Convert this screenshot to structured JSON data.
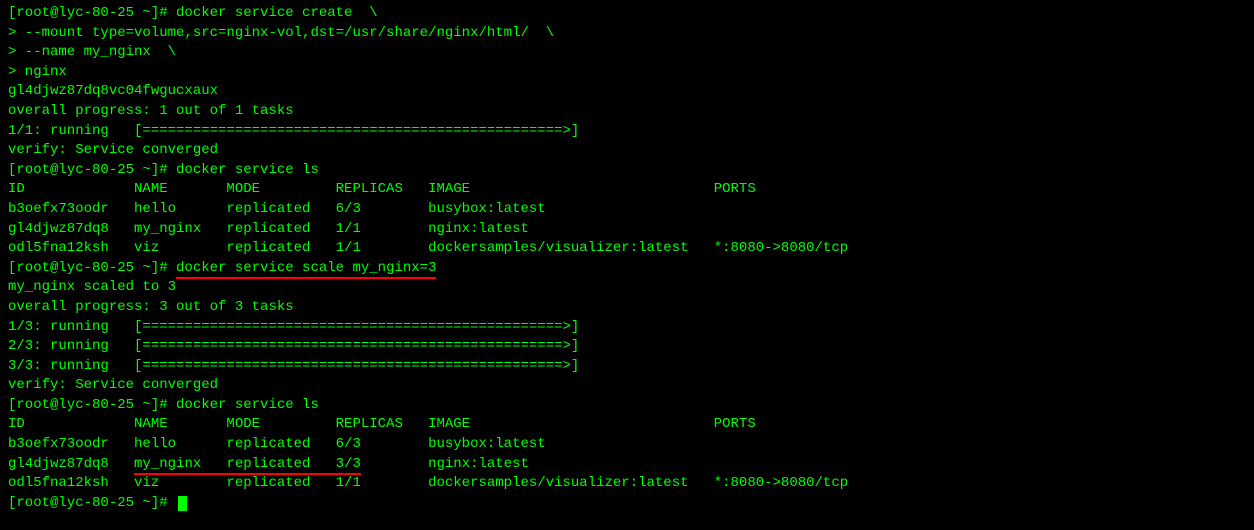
{
  "prompt": {
    "user": "root",
    "host": "lyc-80-25",
    "path": "~",
    "symbol": "#"
  },
  "lines": {
    "l1": "[root@lyc-80-25 ~]# docker service create  \\",
    "l2": "> --mount type=volume,src=nginx-vol,dst=/usr/share/nginx/html/  \\",
    "l3": "> --name my_nginx  \\",
    "l4": "> nginx",
    "l5": "gl4djwz87dq8vc04fwgucxaux",
    "l6": "overall progress: 1 out of 1 tasks",
    "l7": "1/1: running   [==================================================>]",
    "l8": "verify: Service converged",
    "l9": "[root@lyc-80-25 ~]# docker service ls",
    "l10": "ID             NAME       MODE         REPLICAS   IMAGE                             PORTS",
    "l11": "b3oefx73oodr   hello      replicated   6/3        busybox:latest",
    "l12": "gl4djwz87dq8   my_nginx   replicated   1/1        nginx:latest",
    "l13": "odl5fna12ksh   viz        replicated   1/1        dockersamples/visualizer:latest   *:8080->8080/tcp",
    "l14_prefix": "[root@lyc-80-25 ~]# ",
    "l14_cmd": "docker service scale my_nginx=3",
    "l15": "my_nginx scaled to 3",
    "l16": "overall progress: 3 out of 3 tasks",
    "l17": "1/3: running   [==================================================>]",
    "l18": "2/3: running   [==================================================>]",
    "l19": "3/3: running   [==================================================>]",
    "l20": "verify: Service converged",
    "l21": "[root@lyc-80-25 ~]# docker service ls",
    "l22": "ID             NAME       MODE         REPLICAS   IMAGE                             PORTS",
    "l23": "b3oefx73oodr   hello      replicated   6/3        busybox:latest",
    "l24_id": "gl4djwz87dq8   ",
    "l24_underlined": "my_nginx   replicated   3/3",
    "l24_rest": "        nginx:latest",
    "l25": "odl5fna12ksh   viz        replicated   1/1        dockersamples/visualizer:latest   *:8080->8080/tcp",
    "l26": "[root@lyc-80-25 ~]# "
  },
  "services_table_1": {
    "headers": [
      "ID",
      "NAME",
      "MODE",
      "REPLICAS",
      "IMAGE",
      "PORTS"
    ],
    "rows": [
      {
        "id": "b3oefx73oodr",
        "name": "hello",
        "mode": "replicated",
        "replicas": "6/3",
        "image": "busybox:latest",
        "ports": ""
      },
      {
        "id": "gl4djwz87dq8",
        "name": "my_nginx",
        "mode": "replicated",
        "replicas": "1/1",
        "image": "nginx:latest",
        "ports": ""
      },
      {
        "id": "odl5fna12ksh",
        "name": "viz",
        "mode": "replicated",
        "replicas": "1/1",
        "image": "dockersamples/visualizer:latest",
        "ports": "*:8080->8080/tcp"
      }
    ]
  },
  "services_table_2": {
    "headers": [
      "ID",
      "NAME",
      "MODE",
      "REPLICAS",
      "IMAGE",
      "PORTS"
    ],
    "rows": [
      {
        "id": "b3oefx73oodr",
        "name": "hello",
        "mode": "replicated",
        "replicas": "6/3",
        "image": "busybox:latest",
        "ports": ""
      },
      {
        "id": "gl4djwz87dq8",
        "name": "my_nginx",
        "mode": "replicated",
        "replicas": "3/3",
        "image": "nginx:latest",
        "ports": ""
      },
      {
        "id": "odl5fna12ksh",
        "name": "viz",
        "mode": "replicated",
        "replicas": "1/1",
        "image": "dockersamples/visualizer:latest",
        "ports": "*:8080->8080/tcp"
      }
    ]
  }
}
